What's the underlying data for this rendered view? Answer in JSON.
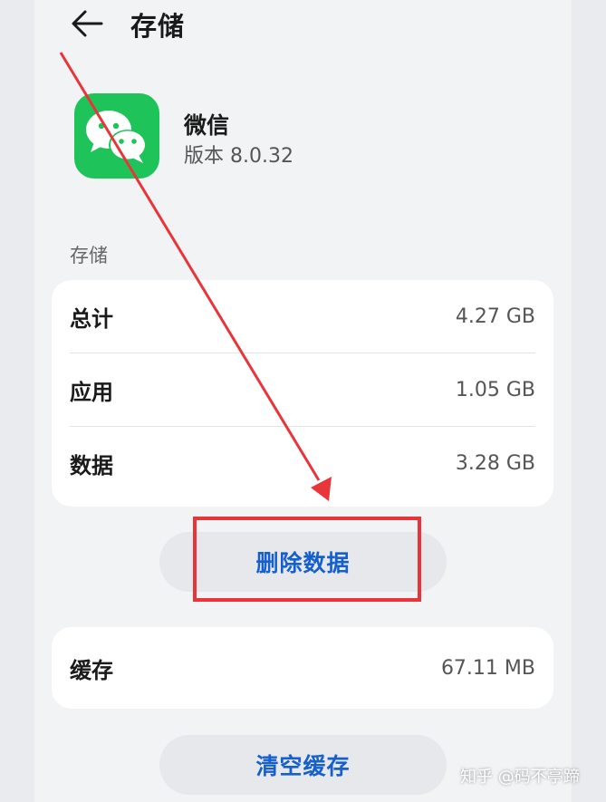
{
  "header": {
    "title": "存储",
    "back_icon": "arrow-left-icon"
  },
  "app": {
    "name": "微信",
    "version": "版本 8.0.32",
    "icon": "wechat-logo-icon",
    "brand_color": "#1ec45a"
  },
  "storage": {
    "section_label": "存储",
    "rows": [
      {
        "label": "总计",
        "value": "4.27 GB"
      },
      {
        "label": "应用",
        "value": "1.05 GB"
      },
      {
        "label": "数据",
        "value": "3.28 GB"
      }
    ],
    "delete_button": "删除数据"
  },
  "cache": {
    "label": "缓存",
    "value": "67.11 MB",
    "clear_button": "清空缓存"
  },
  "annotation": {
    "color": "#e8353a"
  },
  "watermark": "知乎 @码不亭蹄"
}
